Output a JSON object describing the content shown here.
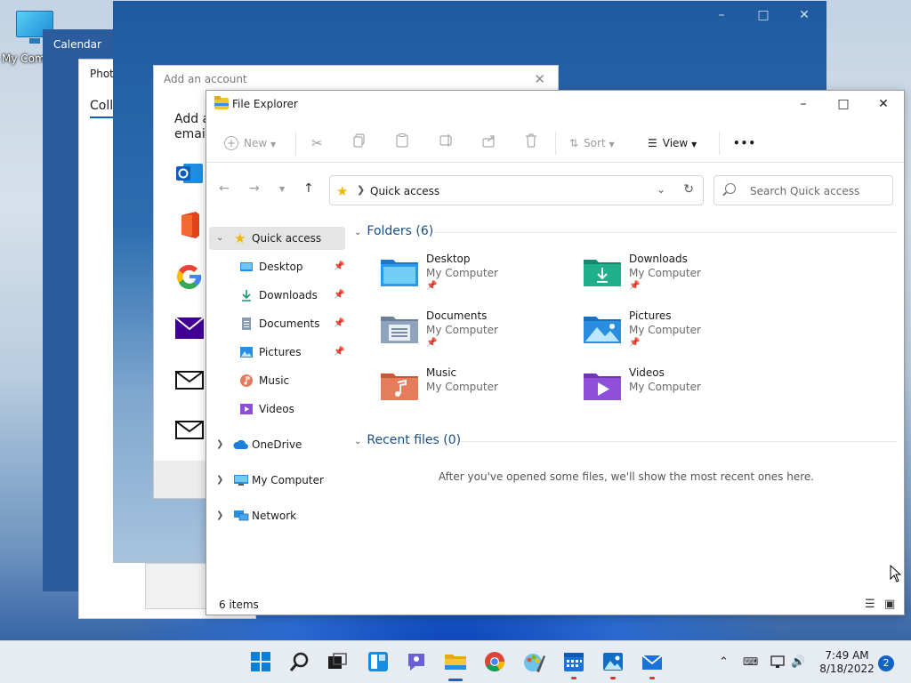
{
  "desktop": {
    "icon_label": "My Computer"
  },
  "calendar_window": {
    "title": "Calendar"
  },
  "photos_window": {
    "title": "Photo",
    "tab": "Colle"
  },
  "account_window": {
    "title": "Add an account",
    "heading_line1": "Add a",
    "heading_line2": "email,",
    "logos": [
      "outlook-icon",
      "office-icon",
      "google-icon",
      "yahoo-mail-icon",
      "mail-icon",
      "mail-icon"
    ]
  },
  "file_explorer": {
    "title": "File Explorer",
    "commands": {
      "new": "New",
      "sort": "Sort",
      "view": "View",
      "more": "•••"
    },
    "address": "Quick access",
    "search_placeholder": "Search Quick access",
    "nav": {
      "quick_access": "Quick access",
      "items": [
        {
          "label": "Desktop",
          "pinned": true
        },
        {
          "label": "Downloads",
          "pinned": true
        },
        {
          "label": "Documents",
          "pinned": true
        },
        {
          "label": "Pictures",
          "pinned": true
        },
        {
          "label": "Music",
          "pinned": false
        },
        {
          "label": "Videos",
          "pinned": false
        }
      ],
      "onedrive": "OneDrive",
      "my_computer": "My Computer",
      "network": "Network"
    },
    "folders_header": "Folders (6)",
    "folders": [
      {
        "name": "Desktop",
        "location": "My Computer",
        "pinned": true
      },
      {
        "name": "Downloads",
        "location": "My Computer",
        "pinned": true
      },
      {
        "name": "Documents",
        "location": "My Computer",
        "pinned": true
      },
      {
        "name": "Pictures",
        "location": "My Computer",
        "pinned": true
      },
      {
        "name": "Music",
        "location": "My Computer",
        "pinned": false
      },
      {
        "name": "Videos",
        "location": "My Computer",
        "pinned": false
      }
    ],
    "recent_header": "Recent files (0)",
    "recent_empty": "After you've opened some files, we'll show the most recent ones here.",
    "status": "6 items"
  },
  "taskbar": {
    "apps": [
      "start-icon",
      "search-icon",
      "task-view-icon",
      "widgets-icon",
      "chat-icon",
      "file-explorer-icon",
      "chrome-icon",
      "paint-icon",
      "calendar-icon",
      "photos-icon",
      "mail-icon"
    ],
    "time": "7:49 AM",
    "date": "8/18/2022",
    "notifications": "2"
  },
  "colors": {
    "accent": "#0a66c8",
    "folder_blue": "#1e88d8",
    "folder_teal": "#17a589"
  }
}
